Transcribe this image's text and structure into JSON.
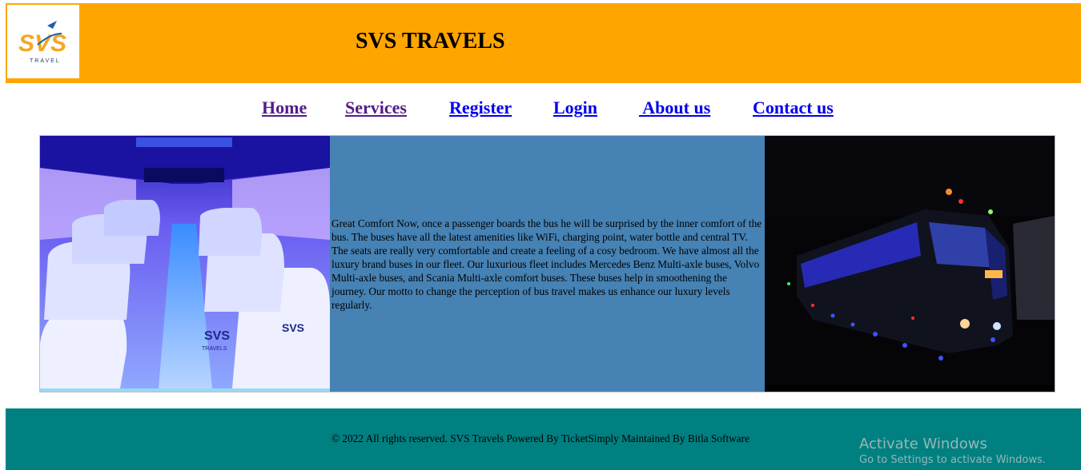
{
  "header": {
    "logo_text": "SVS",
    "logo_subtext": "TRAVEL",
    "title": "SVS TRAVELS"
  },
  "nav": {
    "items": [
      {
        "label": "Home",
        "visited": true
      },
      {
        "label": "Services",
        "visited": true
      },
      {
        "label": "Register",
        "visited": false
      },
      {
        "label": "Login",
        "visited": false
      },
      {
        "label": " About us",
        "visited": false
      },
      {
        "label": "Contact us",
        "visited": false
      }
    ]
  },
  "content": {
    "description": "Great Comfort Now, once a passenger boards the bus he will be surprised by the inner comfort of the bus. The buses have all the latest amenities like WiFi, charging point, water bottle and central TV. The seats are really very comfortable and create a feeling of a cosy bedroom. We have almost all the luxury brand buses in our fleet. Our luxurious fleet includes Mercedes Benz Multi-axle buses, Volvo Multi-axle buses, and Scania Multi-axle comfort buses. These buses help in smoothening the journey. Our motto to change the perception of bus travel makes us enhance our luxury levels regularly.",
    "seat_cover_text": "SVS",
    "seat_cover_subtext": "TRAVELS"
  },
  "footer": {
    "copyright": "© 2022 All rights reserved. SVS Travels Powered By TicketSimply Maintained By Bitla Software"
  },
  "os_overlay": {
    "activate_title": "Activate Windows",
    "activate_subtitle": "Go to Settings to activate Windows."
  },
  "colors": {
    "header_bg": "#ffa500",
    "middle_panel_bg": "#4682b4",
    "footer_bg": "#008080",
    "link": "#0000ee",
    "link_visited": "#551a8b"
  }
}
